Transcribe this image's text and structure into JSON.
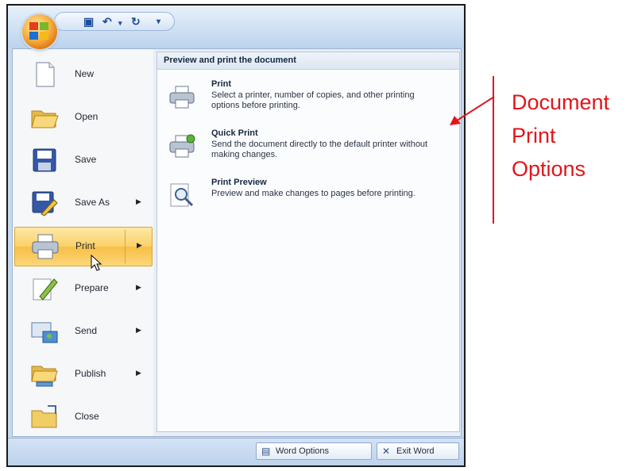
{
  "menu_commands": [
    {
      "label": "New",
      "arrow": ""
    },
    {
      "label": "Open",
      "arrow": ""
    },
    {
      "label": "Save",
      "arrow": ""
    },
    {
      "label": "Save As",
      "arrow": "▶"
    },
    {
      "label": "Print",
      "arrow": "▶"
    },
    {
      "label": "Prepare",
      "arrow": "▶"
    },
    {
      "label": "Send",
      "arrow": "▶"
    },
    {
      "label": "Publish",
      "arrow": "▶"
    },
    {
      "label": "Close",
      "arrow": ""
    }
  ],
  "submenu": {
    "title": "Preview and print the document",
    "items": [
      {
        "title": "Print",
        "desc": "Select a printer, number of copies, and other printing options before printing."
      },
      {
        "title": "Quick Print",
        "desc": "Send the document directly to the default printer without making changes."
      },
      {
        "title": "Print Preview",
        "desc": "Preview and make changes to pages before printing."
      }
    ]
  },
  "bottom_buttons": {
    "word_options": "Word Options",
    "exit_word": "Exit Word"
  },
  "annotation": {
    "line1": "Document",
    "line2": "Print",
    "line3": "Options"
  },
  "colors": {
    "accent_highlight": "#f7bf45",
    "annotation": "#e0161b",
    "frame": "#c6d9ee"
  },
  "qat_icons": [
    "save-icon",
    "undo-icon",
    "redo-icon",
    "customize-icon"
  ]
}
